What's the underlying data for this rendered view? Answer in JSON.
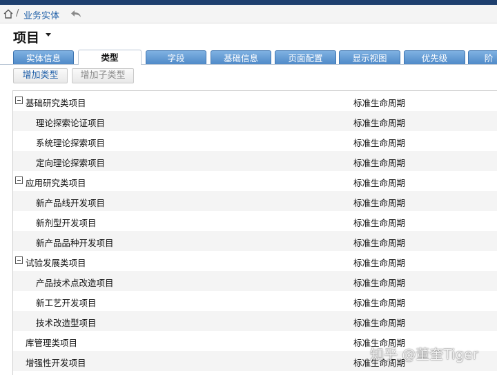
{
  "breadcrumb": {
    "separator": "/",
    "section": "业务实体"
  },
  "page": {
    "title": "项目"
  },
  "tabs": [
    {
      "label": "实体信息"
    },
    {
      "label": "类型",
      "active": true
    },
    {
      "label": "字段"
    },
    {
      "label": "基础信息"
    },
    {
      "label": "页面配置"
    },
    {
      "label": "显示视图"
    },
    {
      "label": "优先级"
    },
    {
      "label": "阶"
    }
  ],
  "toolbar": {
    "add_type": "增加类型",
    "add_subtype": "增加子类型"
  },
  "rows": [
    {
      "name": "基础研究类项目",
      "lifecycle": "标准生命周期",
      "level": 0,
      "expanded": true
    },
    {
      "name": "理论探索论证项目",
      "lifecycle": "标准生命周期",
      "level": 1
    },
    {
      "name": "系统理论探索项目",
      "lifecycle": "标准生命周期",
      "level": 1
    },
    {
      "name": "定向理论探索项目",
      "lifecycle": "标准生命周期",
      "level": 1
    },
    {
      "name": "应用研究类项目",
      "lifecycle": "标准生命周期",
      "level": 0,
      "expanded": true
    },
    {
      "name": "新产品线开发项目",
      "lifecycle": "标准生命周期",
      "level": 1
    },
    {
      "name": "新剂型开发项目",
      "lifecycle": "标准生命周期",
      "level": 1
    },
    {
      "name": "新产品品种开发项目",
      "lifecycle": "标准生命周期",
      "level": 1
    },
    {
      "name": "试验发展类项目",
      "lifecycle": "标准生命周期",
      "level": 0,
      "expanded": true
    },
    {
      "name": "产品技术点改造项目",
      "lifecycle": "标准生命周期",
      "level": 1
    },
    {
      "name": "新工艺开发项目",
      "lifecycle": "标准生命周期",
      "level": 1
    },
    {
      "name": "技术改造型项目",
      "lifecycle": "标准生命周期",
      "level": 1
    },
    {
      "name": "库管理类项目",
      "lifecycle": "标准生命周期",
      "level": 0
    },
    {
      "name": "增强性开发项目",
      "lifecycle": "标准生命周期",
      "level": 0
    }
  ],
  "watermark": "知乎 @董奎Tiger",
  "colors": {
    "accent": "#1f5fa8",
    "tab": "#5b93cf",
    "header": "#1e3f6e"
  }
}
